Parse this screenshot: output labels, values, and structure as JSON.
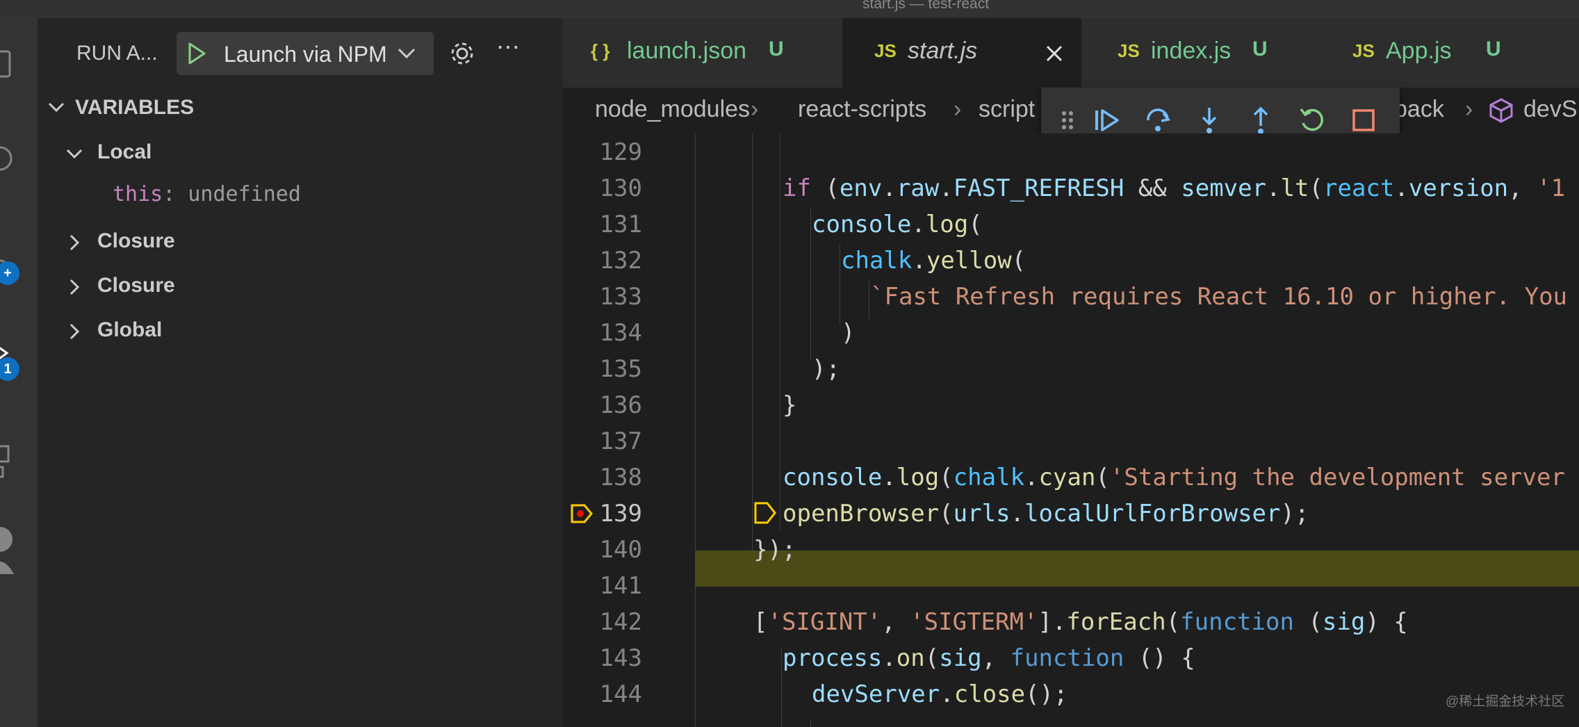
{
  "window": {
    "title": "start.js — test-react"
  },
  "activity_bar": {
    "badges": [
      "+",
      "1"
    ]
  },
  "sidebar": {
    "header": {
      "title": "RUN A...",
      "launch_config": "Launch via NPM"
    },
    "variables": {
      "section_title": "VARIABLES",
      "scopes": [
        {
          "label": "Local",
          "expanded": true
        },
        {
          "label": "Closure",
          "expanded": false
        },
        {
          "label": "Closure",
          "expanded": false
        },
        {
          "label": "Global",
          "expanded": false
        }
      ],
      "local_vars": [
        {
          "name": "this",
          "sep": ": ",
          "value": "undefined"
        }
      ]
    }
  },
  "tabs": [
    {
      "icon": "{ }",
      "name": "launch.json",
      "status": "U",
      "active": false
    },
    {
      "icon": "JS",
      "name": "start.js",
      "status": "",
      "active": true
    },
    {
      "icon": "JS",
      "name": "index.js",
      "status": "U",
      "active": false
    },
    {
      "icon": "JS",
      "name": "App.js",
      "status": "U",
      "active": false
    }
  ],
  "breadcrumb": {
    "items": [
      "node_modules",
      "react-scripts",
      "script",
      "back",
      "devS"
    ]
  },
  "editor": {
    "current_line": 139,
    "lines": [
      {
        "n": "129"
      },
      {
        "n": "130"
      },
      {
        "n": "131"
      },
      {
        "n": "132"
      },
      {
        "n": "133"
      },
      {
        "n": "134"
      },
      {
        "n": "135"
      },
      {
        "n": "136"
      },
      {
        "n": "137"
      },
      {
        "n": "138"
      },
      {
        "n": "139"
      },
      {
        "n": "140"
      },
      {
        "n": "141"
      },
      {
        "n": "142"
      },
      {
        "n": "143"
      },
      {
        "n": "144"
      }
    ],
    "code": {
      "l129": "",
      "l130": [
        "if",
        " (",
        "env",
        ".",
        "raw",
        ".",
        "FAST_REFRESH",
        " && ",
        "semver",
        ".",
        "lt",
        "(",
        "react",
        ".",
        "version",
        ", ",
        "'1"
      ],
      "l131": [
        "console",
        ".",
        "log",
        "("
      ],
      "l132": [
        "chalk",
        ".",
        "yellow",
        "("
      ],
      "l133": "`Fast Refresh requires React 16.10 or higher. You",
      "l134": ")",
      "l135": ");",
      "l136": "}",
      "l138": [
        "console",
        ".",
        "log",
        "(",
        "chalk",
        ".",
        "cyan",
        "(",
        "'Starting the development server"
      ],
      "l139": [
        "openBrowser",
        "(",
        "urls",
        ".",
        "localUrlForBrowser",
        ");"
      ],
      "l140": "});",
      "l142": [
        "[",
        "'SIGINT'",
        ", ",
        "'SIGTERM'",
        "].",
        "forEach",
        "(",
        "function",
        " (",
        "sig",
        ") {"
      ],
      "l143": [
        "process",
        ".",
        "on",
        "(",
        "sig",
        ", ",
        "function",
        " () {"
      ],
      "l144": [
        "devServer",
        ".",
        "close",
        "();"
      ]
    }
  },
  "watermark": "@稀土掘金技术社区",
  "colors": {
    "highlight_line": "#4b4b18",
    "breakpoint": "#e51400",
    "debug_arrow": "#ffcc00",
    "modified": "#73c991"
  }
}
